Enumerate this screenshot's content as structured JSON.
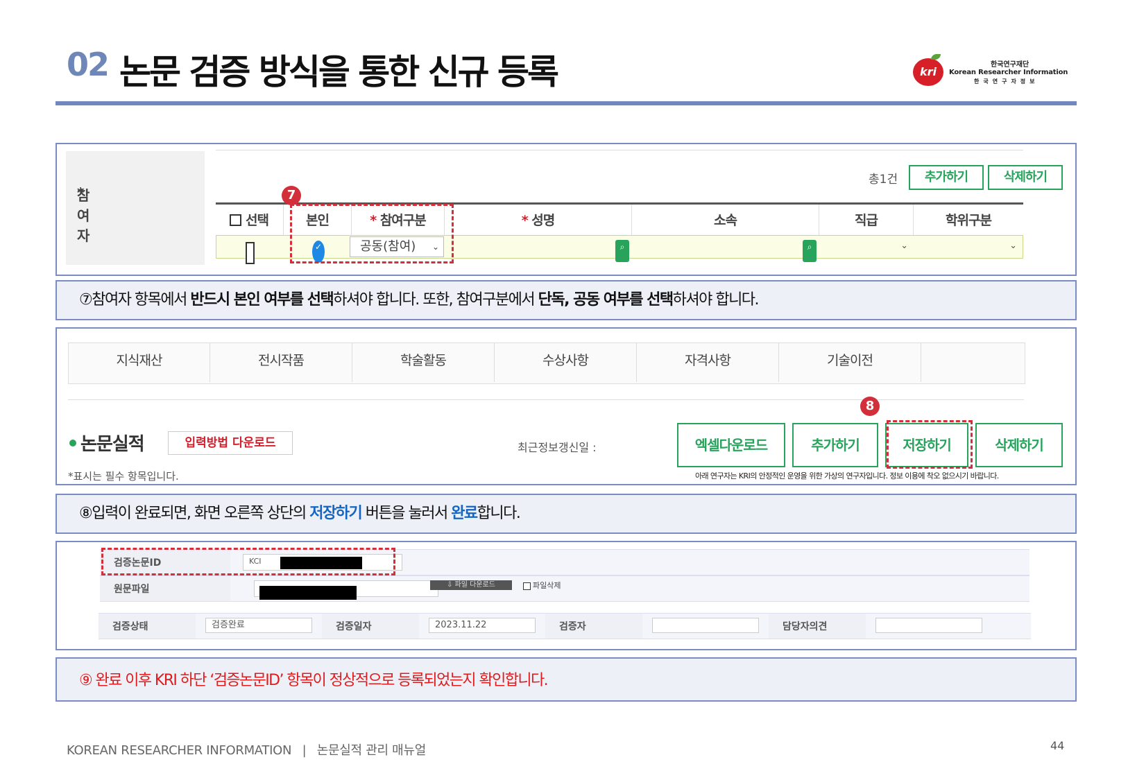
{
  "header": {
    "number": "02",
    "title": "논문 검증 방식을 통한 신규 등록",
    "logo": {
      "mark": "kri",
      "korean_name": "한국연구재단",
      "english_name": "Korean Researcher Information",
      "korean_sub": "한국연구자정보"
    }
  },
  "section1": {
    "label": "참여자",
    "required_mark": "*",
    "count": "총1건",
    "add_button": "추가하기",
    "delete_button": "삭제하기",
    "columns": [
      "선택",
      "본인",
      "참여구분",
      "성명",
      "소속",
      "직급",
      "학위구분"
    ],
    "row": {
      "participation_type": "공동(참여)"
    },
    "badge": "7"
  },
  "note1": {
    "parts": [
      "⑦참여자 항목에서 ",
      "반드시 본인 여부를 선택",
      "하셔야 합니다. 또한, 참여구분에서 ",
      "단독, 공동 여부를 선택",
      "하셔야 합니다."
    ]
  },
  "section2": {
    "tabs": [
      "지식재산",
      "전시작품",
      "학술활동",
      "수상사항",
      "자격사항",
      "기술이전"
    ],
    "title": "논문실적",
    "download_method_button": "입력방법 다운로드",
    "recent_update_label": "최근정보갱신일 :",
    "buttons": [
      "엑셀다운로드",
      "추가하기",
      "저장하기",
      "삭제하기"
    ],
    "required_note": "*표시는 필수 항목입니다.",
    "virtual_note": "아래 연구자는 KRI의 안정적인 운영을 위한 가상의 연구자입니다. 정보 이용에 착오 없으시기 바랍니다.",
    "badge": "8"
  },
  "note2": {
    "parts": [
      "⑧입력이 완료되면, 화면 오른쪽 상단의 ",
      "저장하기",
      " 버튼을 눌러서 ",
      "완료",
      "합니다."
    ]
  },
  "section3": {
    "verified_paper_id_label": "검증논문ID",
    "id_prefix": "KCI",
    "original_file_label": "원문파일",
    "file_download_button": "파일 다운로드",
    "file_delete_label": "파일삭제",
    "status_label": "검증상태",
    "status_value": "검증완료",
    "date_label": "검증일자",
    "date_value": "2023.11.22",
    "verifier_label": "검증자",
    "opinion_label": "담당자의견"
  },
  "note3": {
    "text": "⑨ 완료 이후 KRI 하단 ‘검증논문ID’ 항목이 정상적으로 등록되었는지 확인합니다."
  },
  "footer": {
    "brand": "KOREAN RESEARCHER INFORMATION",
    "separator": "|",
    "manual": "논문실적 관리 매뉴얼",
    "page": "44"
  },
  "colors": {
    "accent_blue": "#7088bd",
    "green": "#27a35c",
    "red": "#d21f2b",
    "note_blue": "#1565c0"
  }
}
